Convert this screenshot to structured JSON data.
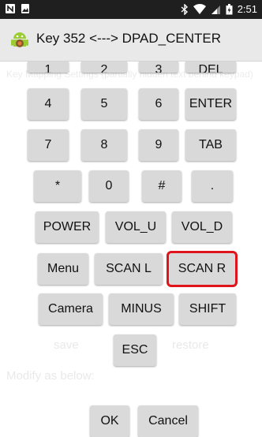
{
  "status_bar": {
    "left_icons": [
      "n-icon",
      "image-icon"
    ],
    "right_icons": [
      "bluetooth-icon",
      "wifi-icon",
      "signal-icon",
      "battery-icon"
    ],
    "time": "2:51"
  },
  "title_bar": {
    "title": "Key 352 <---> DPAD_CENTER"
  },
  "background": {
    "line1": "Key Mapping Settings (partially hidden text behind keypad)",
    "save_label": "save",
    "restore_label": "restore",
    "modify_label": "Modify as below:"
  },
  "keypad": {
    "row0": [
      "1",
      "2",
      "3",
      "DEL"
    ],
    "row1": [
      "4",
      "5",
      "6",
      "ENTER"
    ],
    "row2": [
      "7",
      "8",
      "9",
      "TAB"
    ],
    "row3": [
      "*",
      "0",
      "#",
      "."
    ],
    "row4": [
      "POWER",
      "VOL_U",
      "VOL_D"
    ],
    "row5": [
      "Menu",
      "SCAN L",
      "SCAN R"
    ],
    "row6": [
      "Camera",
      "MINUS",
      "SHIFT"
    ],
    "row7": [
      "ESC"
    ]
  },
  "dialog_buttons": {
    "ok": "OK",
    "cancel": "Cancel"
  },
  "colors": {
    "highlight": "#e0141b",
    "key_bg": "#d9d9d9",
    "title_bg": "#e9e9e9",
    "status_bg": "#1f1f1f"
  }
}
